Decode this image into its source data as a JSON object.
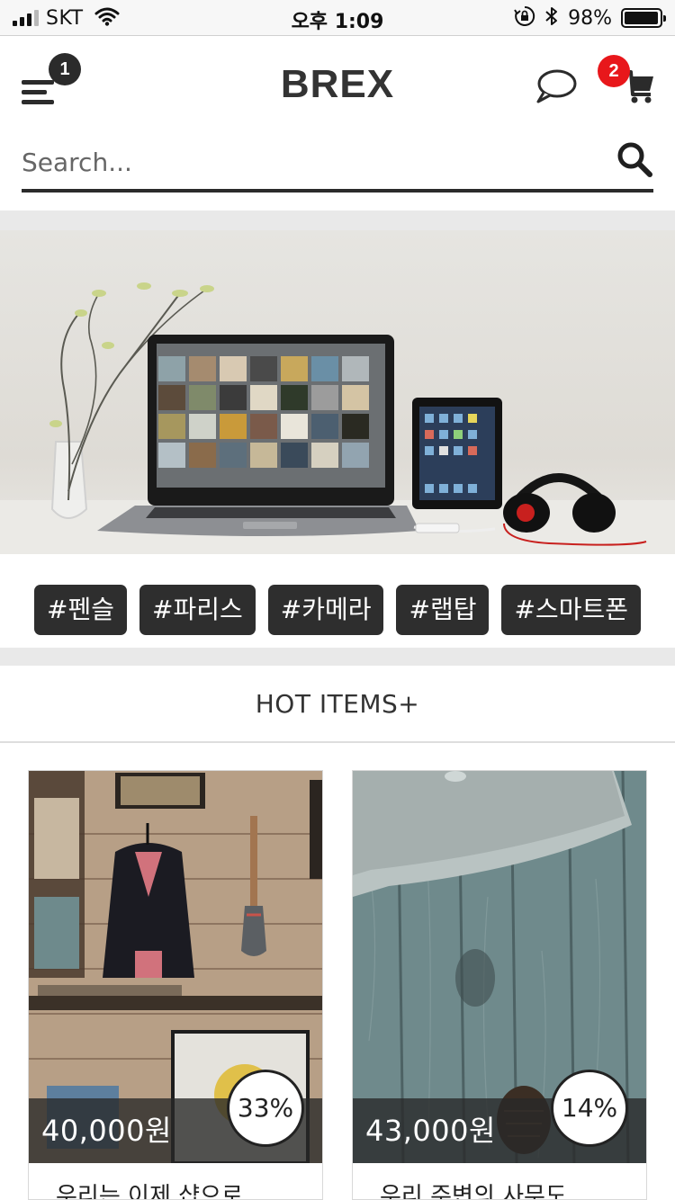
{
  "status_bar": {
    "carrier": "SKT",
    "time": "오후 1:09",
    "battery_percent": "98%",
    "battery_level": 0.98,
    "signal_bars": 3,
    "icons": [
      "wifi-icon",
      "orientation-lock-icon",
      "bluetooth-icon",
      "battery-icon"
    ]
  },
  "header": {
    "logo": "BREX",
    "menu_badge": "1",
    "cart_badge": "2",
    "icons": [
      "menu-icon",
      "chat-icon",
      "cart-icon"
    ],
    "badge_colors": {
      "menu": "#2b2b2b",
      "cart": "#e8171b"
    }
  },
  "search": {
    "placeholder": "Search...",
    "icon": "search-icon"
  },
  "hero": {
    "description_icon": "hero-banner-image"
  },
  "tags": [
    "#펜슬",
    "#파리스",
    "#카메라",
    "#랩탑",
    "#스마트폰"
  ],
  "section": {
    "title": "HOT ITEMS+"
  },
  "products": [
    {
      "price": "40,000원",
      "discount": "33%",
      "name": "우리는 이제 샵으로"
    },
    {
      "price": "43,000원",
      "discount": "14%",
      "name": "우리 주변의 사무도"
    }
  ]
}
